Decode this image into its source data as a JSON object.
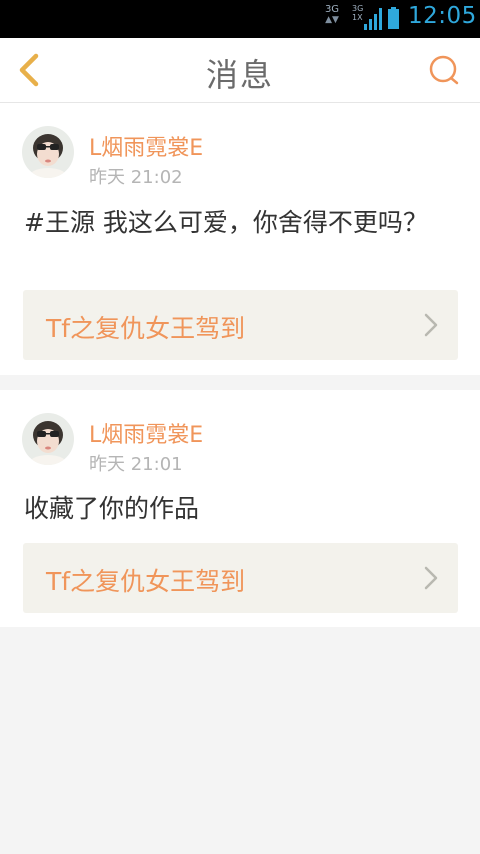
{
  "status_bar": {
    "network_left": "3G",
    "network_right_top": "3G",
    "network_right_bottom": "1X",
    "time": "12:05",
    "accent_color": "#2fa8dc"
  },
  "header": {
    "title": "消息",
    "back_icon": "chevron-left-icon",
    "search_icon": "search-icon"
  },
  "messages": [
    {
      "username": "L烟雨霓裳E",
      "timestamp": "昨天 21:02",
      "content": "#王源 我这么可爱，你舍得不更吗？",
      "work_title": "Tf之复仇女王驾到"
    },
    {
      "username": "L烟雨霓裳E",
      "timestamp": "昨天 21:01",
      "content": "收藏了你的作品",
      "work_title": "Tf之复仇女王驾到"
    }
  ],
  "colors": {
    "accent": "#f0955a",
    "back_icon": "#e8b04a",
    "background": "#f4f4f4",
    "link_background": "#f3f2ec"
  }
}
